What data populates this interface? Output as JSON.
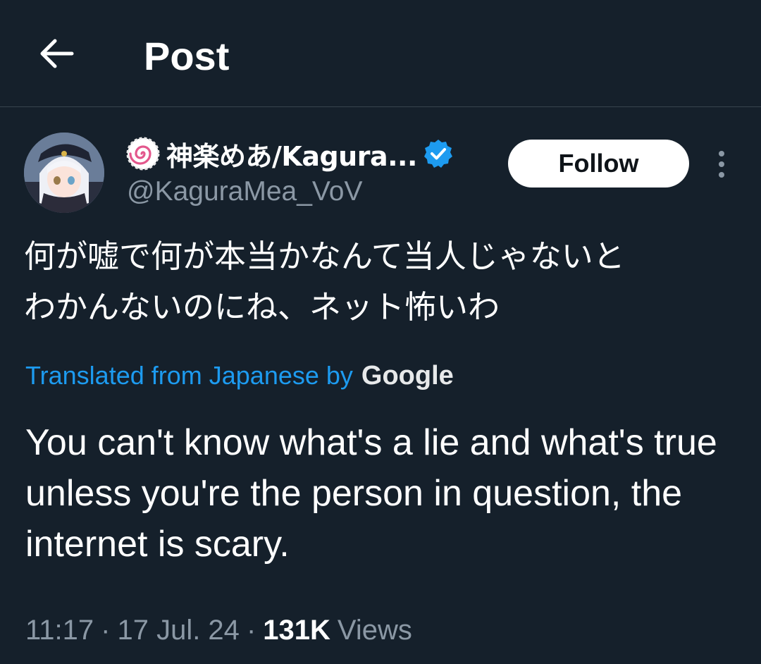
{
  "header": {
    "title": "Post",
    "back_icon": "arrow-left-icon"
  },
  "author": {
    "display_name": "神楽めあ/Kagura...",
    "handle": "@KaguraMea_VoV",
    "name_emoji_icon": "narutomaki-emoji-icon",
    "verified_icon": "verified-badge-icon",
    "verified_color": "#1d9bf0"
  },
  "actions": {
    "follow_label": "Follow",
    "more_icon": "more-vertical-icon"
  },
  "post": {
    "original_line1": "何が嘘で何が本当かなんて当人じゃないと",
    "original_line2": "わかんないのにね、ネット怖いわ",
    "translated_from": "Translated from Japanese by",
    "translator": "Google",
    "translation": "You can't know what's a lie and what's true unless you're the person in question, the internet is scary.",
    "time": "11:17",
    "date": "17 Jul. 24",
    "views_count": "131K",
    "views_label": "Views"
  },
  "colors": {
    "background": "#15202b",
    "text": "#ffffff",
    "secondary_text": "#8b98a5",
    "link": "#1d9bf0",
    "divider": "#38444d"
  }
}
